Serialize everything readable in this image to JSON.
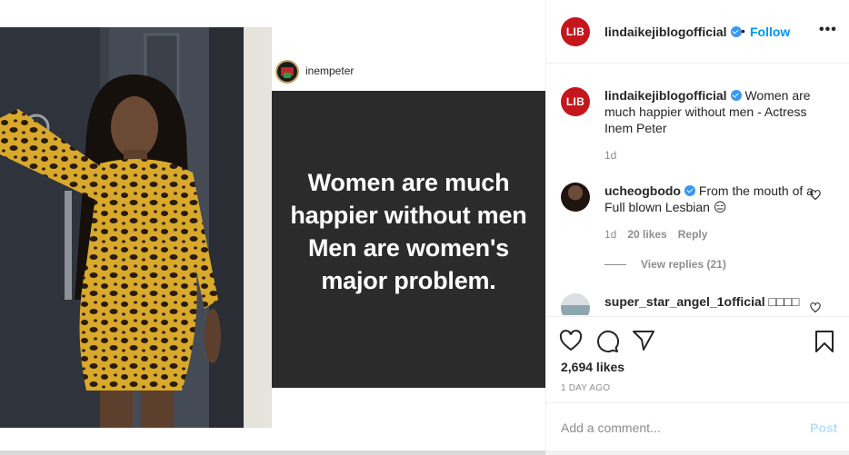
{
  "post": {
    "author": "lindaikejiblogofficial",
    "author_logo_text": "LIB",
    "header_separator": "•",
    "follow_label": "Follow",
    "more_label": "•••",
    "media": {
      "photo_description_icon": "photo-image",
      "quote_username": "inempeter",
      "quote_lines": [
        "Women are much",
        "happier without men",
        "Men are women's",
        "major problem."
      ]
    },
    "caption": {
      "username": "lindaikejiblogofficial",
      "text": "Women are much happier without men - Actress Inem Peter",
      "time": "1d"
    },
    "comments": [
      {
        "username": "ucheogbodo",
        "text": "From the mouth of a Full blown Lesbian 😑",
        "time": "1d",
        "likes": "20 likes",
        "reply_label": "Reply",
        "view_replies": "View replies (21)"
      },
      {
        "username": "super_star_angel_1official",
        "text": "□□□□"
      }
    ],
    "likes_count": "2,694 likes",
    "date": "1 DAY AGO",
    "comment_placeholder": "Add a comment...",
    "post_label": "Post"
  },
  "colors": {
    "accent": "#0095f6",
    "brand_red": "#c4161c",
    "verified": "#3897f0",
    "quote_bg": "#2b2b2b",
    "muted": "#8e8e8e"
  }
}
